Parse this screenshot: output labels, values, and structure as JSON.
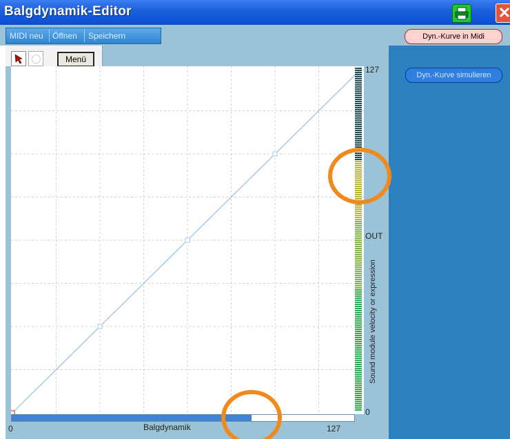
{
  "window": {
    "title": "Balgdynamik-Editor",
    "print_icon": "printer-icon",
    "close_icon": "close-x-icon",
    "close_glyph": "✕"
  },
  "menu": {
    "items": [
      "MIDI neu",
      "Öffnen",
      "Speichern"
    ],
    "save_curve_button": "Dyn.-Kurve in Midi speichern"
  },
  "toolbar": {
    "arrow_tool_icon": "arrow-pointer-icon",
    "circle_tool_icon": "circle-icon",
    "menu_button": "Menü"
  },
  "right_panel": {
    "simulate_button": "Dyn.-Kurve simulieren"
  },
  "chart": {
    "x_label": "Balgdynamik",
    "x_min_label": "0",
    "x_max_label": "127",
    "y_top_label": "127",
    "y_mid_label": "OUT",
    "y_bottom_label": "0",
    "y_axis_title": "Sound module velocity or expression",
    "accent_color": "#a7c8e8",
    "meter_level": 0.73,
    "scroll_fill": 0.7
  },
  "chart_data": {
    "type": "line",
    "x": [
      0,
      31.75,
      63.5,
      95.25,
      127
    ],
    "y": [
      0,
      31.75,
      63.5,
      95.25,
      127
    ],
    "xlim": [
      0,
      127
    ],
    "ylim": [
      0,
      127
    ],
    "grid": true
  },
  "annotations": {
    "highlight_color": "#f08a1c"
  }
}
